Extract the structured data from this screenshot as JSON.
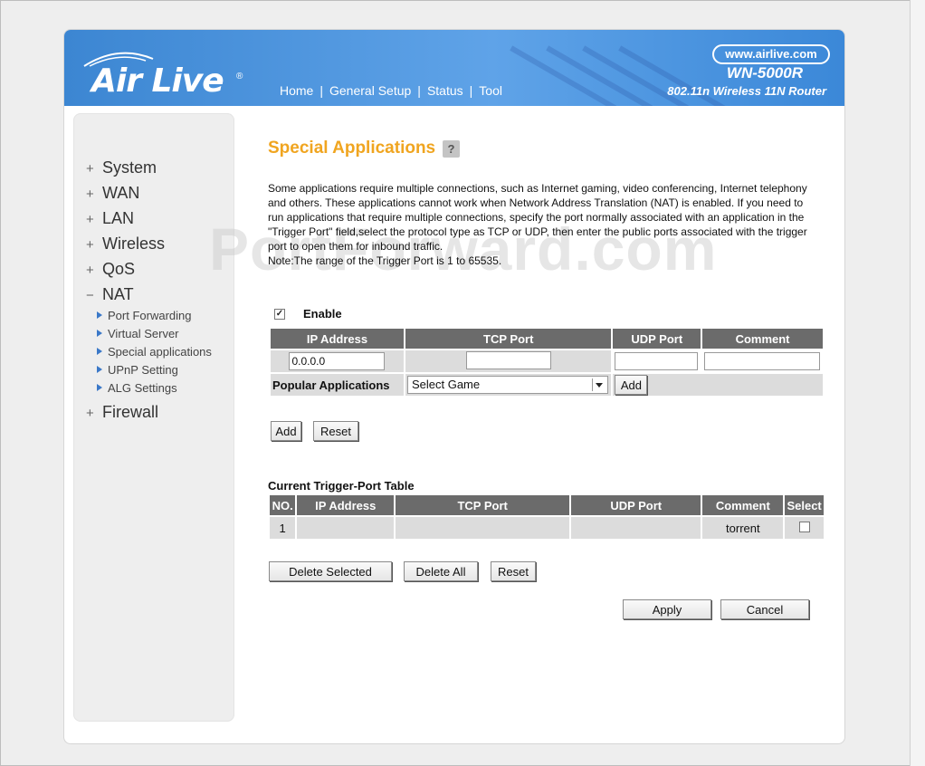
{
  "header": {
    "brand": "Air Live",
    "registered_mark": "®",
    "site": "www.airlive.com",
    "model": "WN-5000R",
    "subtitle": "802.11n Wireless 11N Router",
    "nav": [
      "Home",
      "General Setup",
      "Status",
      "Tool"
    ],
    "nav_separator": "|"
  },
  "sidebar": {
    "items": [
      {
        "sign": "+",
        "label": "System"
      },
      {
        "sign": "+",
        "label": "WAN"
      },
      {
        "sign": "+",
        "label": "LAN"
      },
      {
        "sign": "+",
        "label": "Wireless"
      },
      {
        "sign": "+",
        "label": "QoS"
      },
      {
        "sign": "−",
        "label": "NAT"
      },
      {
        "sign": "+",
        "label": "Firewall"
      }
    ],
    "nat_subitems": [
      "Port Forwarding",
      "Virtual Server",
      "Special applications",
      "UPnP Setting",
      "ALG Settings"
    ]
  },
  "page": {
    "title": "Special Applications",
    "help_icon": "?",
    "watermark": "PortForward.com",
    "description": "Some applications require multiple connections, such as Internet gaming, video conferencing, Internet telephony and others. These applications cannot work when Network Address Translation (NAT) is enabled. If you need to run applications that require multiple connections, specify the port normally associated with an application in the \"Trigger Port\" field,select the protocol type as TCP or UDP, then enter the public ports associated with the trigger port to open them for inbound traffic.",
    "note": "Note:The range of the Trigger Port is 1 to 65535."
  },
  "form": {
    "enable_label": "Enable",
    "enable_checked": "✓",
    "headers": [
      "IP Address",
      "TCP Port",
      "UDP Port",
      "Comment"
    ],
    "ip_value": "0.0.0.0",
    "tcp_value": "",
    "udp_value": "",
    "comment_value": "",
    "popular_label": "Popular Applications",
    "popular_selected": "Select Game",
    "popular_add": "Add",
    "add_button": "Add",
    "reset_button": "Reset"
  },
  "trigger_table": {
    "title": "Current Trigger-Port Table",
    "headers": [
      "NO.",
      "IP Address",
      "TCP Port",
      "UDP Port",
      "Comment",
      "Select"
    ],
    "rows": [
      {
        "no": "1",
        "ip": "",
        "tcp": "",
        "udp": "",
        "comment": "torrent"
      }
    ],
    "delete_selected": "Delete Selected",
    "delete_all": "Delete All",
    "reset": "Reset"
  },
  "actions": {
    "apply": "Apply",
    "cancel": "Cancel"
  }
}
